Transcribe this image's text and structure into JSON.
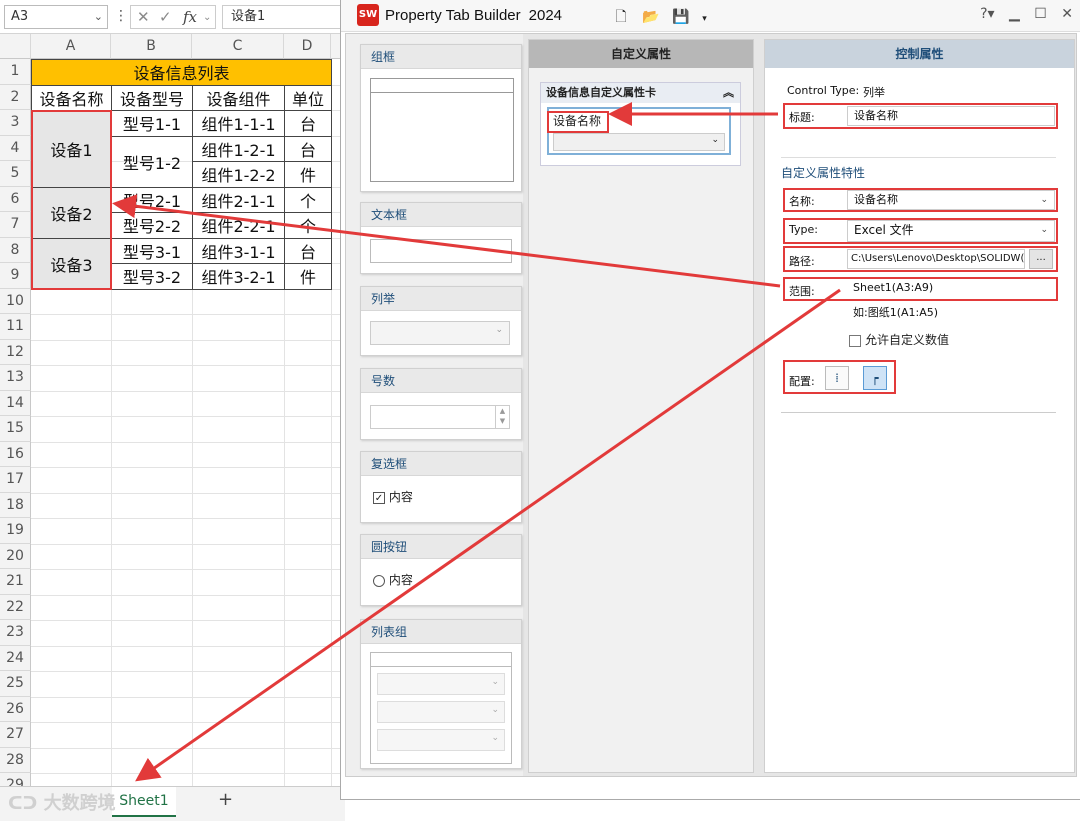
{
  "excel": {
    "name_box": "A3",
    "formula_value": "设备1",
    "fx": "fx",
    "columns": [
      "A",
      "B",
      "C",
      "D"
    ],
    "rows": [
      "1",
      "2",
      "3",
      "4",
      "5",
      "6",
      "7",
      "8",
      "9",
      "10",
      "11",
      "12",
      "13",
      "14",
      "15",
      "16",
      "17",
      "18",
      "19",
      "20",
      "21",
      "22",
      "23",
      "24",
      "25",
      "26",
      "27",
      "28",
      "29"
    ],
    "table_title": "设备信息列表",
    "headers": [
      "设备名称",
      "设备型号",
      "设备组件",
      "单位"
    ],
    "devices": [
      "设备1",
      "设备2",
      "设备3"
    ],
    "models": [
      "型号1-1",
      "型号1-2",
      "型号2-1",
      "型号2-2",
      "型号3-1",
      "型号3-2"
    ],
    "components": [
      "组件1-1-1",
      "组件1-2-1",
      "组件1-2-2",
      "组件2-1-1",
      "组件2-2-1",
      "组件3-1-1",
      "组件3-2-1"
    ],
    "units": [
      "台",
      "台",
      "件",
      "个",
      "个",
      "台",
      "件"
    ],
    "sheet_tab": "Sheet1",
    "add_sheet": "+",
    "watermark": "大数跨境",
    "highlight_color": "#ffc000"
  },
  "sw": {
    "title": "Property Tab Builder",
    "year": "2024",
    "logo": "SW",
    "controls_palette": {
      "groupbox": "组框",
      "textbox": "文本框",
      "list": "列举",
      "number": "号数",
      "checkbox": "复选框",
      "checkbox_item": "内容",
      "radio": "圆按钮",
      "radio_item": "内容",
      "listgroup": "列表组"
    },
    "custom_props": {
      "header": "自定义属性",
      "card_title": "设备信息自定义属性卡",
      "field_label": "设备名称"
    },
    "control_props": {
      "header": "控制属性",
      "control_type_label": "Control Type:",
      "control_type_value": "列举",
      "caption_label": "标题:",
      "caption_value": "设备名称",
      "section_title": "自定义属性特性",
      "name_label": "名称:",
      "name_value": "设备名称",
      "type_label": "Type:",
      "type_value": "Excel 文件",
      "path_label": "路径:",
      "path_value": "C:\\Users\\Lenovo\\Desktop\\SOLIDW(",
      "browse": "...",
      "range_label": "范围:",
      "range_value": "Sheet1(A3:A9)",
      "range_example": "如:图纸1(A1:A5)",
      "allow_custom": "允许自定义数值",
      "config_label": "配置:"
    },
    "accent_red": "#e23a3a"
  }
}
